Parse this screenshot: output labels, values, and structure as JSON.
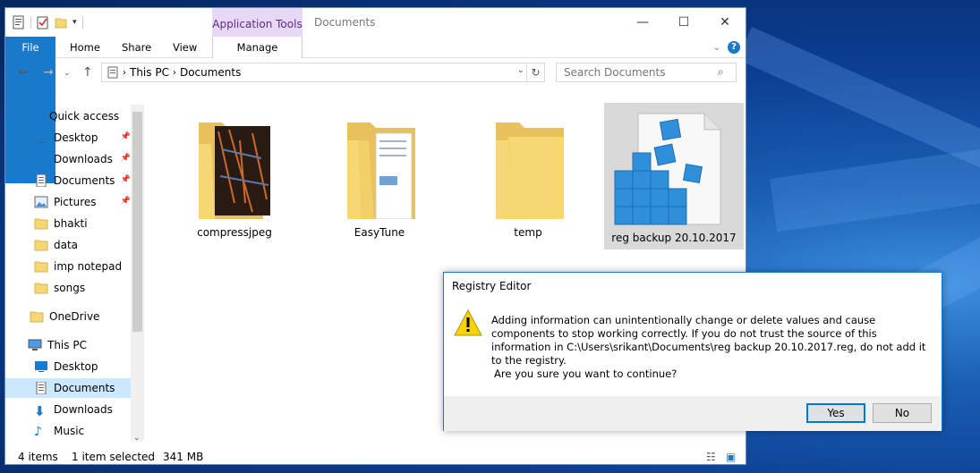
{
  "titlebar": {
    "app_tools_label": "Application Tools",
    "window_title": "Documents",
    "minimize": "—",
    "maximize": "☐",
    "close": "✕"
  },
  "ribbon": {
    "tabs": [
      "File",
      "Home",
      "Share",
      "View"
    ],
    "manage_label": "Manage",
    "help": "?"
  },
  "address": {
    "segments": [
      "This PC",
      "Documents"
    ],
    "search_placeholder": "Search Documents"
  },
  "nav": {
    "quick_access": "Quick access",
    "items": [
      {
        "label": "Desktop",
        "pinned": true
      },
      {
        "label": "Downloads",
        "pinned": true
      },
      {
        "label": "Documents",
        "pinned": true
      },
      {
        "label": "Pictures",
        "pinned": true
      },
      {
        "label": "bhakti",
        "pinned": false
      },
      {
        "label": "data",
        "pinned": false
      },
      {
        "label": "imp notepad",
        "pinned": false
      },
      {
        "label": "songs",
        "pinned": false
      }
    ],
    "onedrive": "OneDrive",
    "this_pc": "This PC",
    "pc_items": [
      "Desktop",
      "Documents",
      "Downloads",
      "Music"
    ]
  },
  "files": [
    {
      "name": "compressjpeg",
      "type": "folder-photo"
    },
    {
      "name": "EasyTune",
      "type": "folder-docs"
    },
    {
      "name": "temp",
      "type": "folder"
    },
    {
      "name": "reg backup 20.10.2017",
      "type": "reg-file",
      "selected": true
    }
  ],
  "status": {
    "items": "4 items",
    "selected": "1 item selected",
    "size": "341 MB"
  },
  "dialog": {
    "title": "Registry Editor",
    "message": "Adding information can unintentionally change or delete values and cause components to stop working correctly. If you do not trust the source of this information in C:\\Users\\srikant\\Documents\\reg backup 20.10.2017.reg, do not add it to the registry.",
    "question": "Are you sure you want to continue?",
    "yes": "Yes",
    "no": "No"
  }
}
